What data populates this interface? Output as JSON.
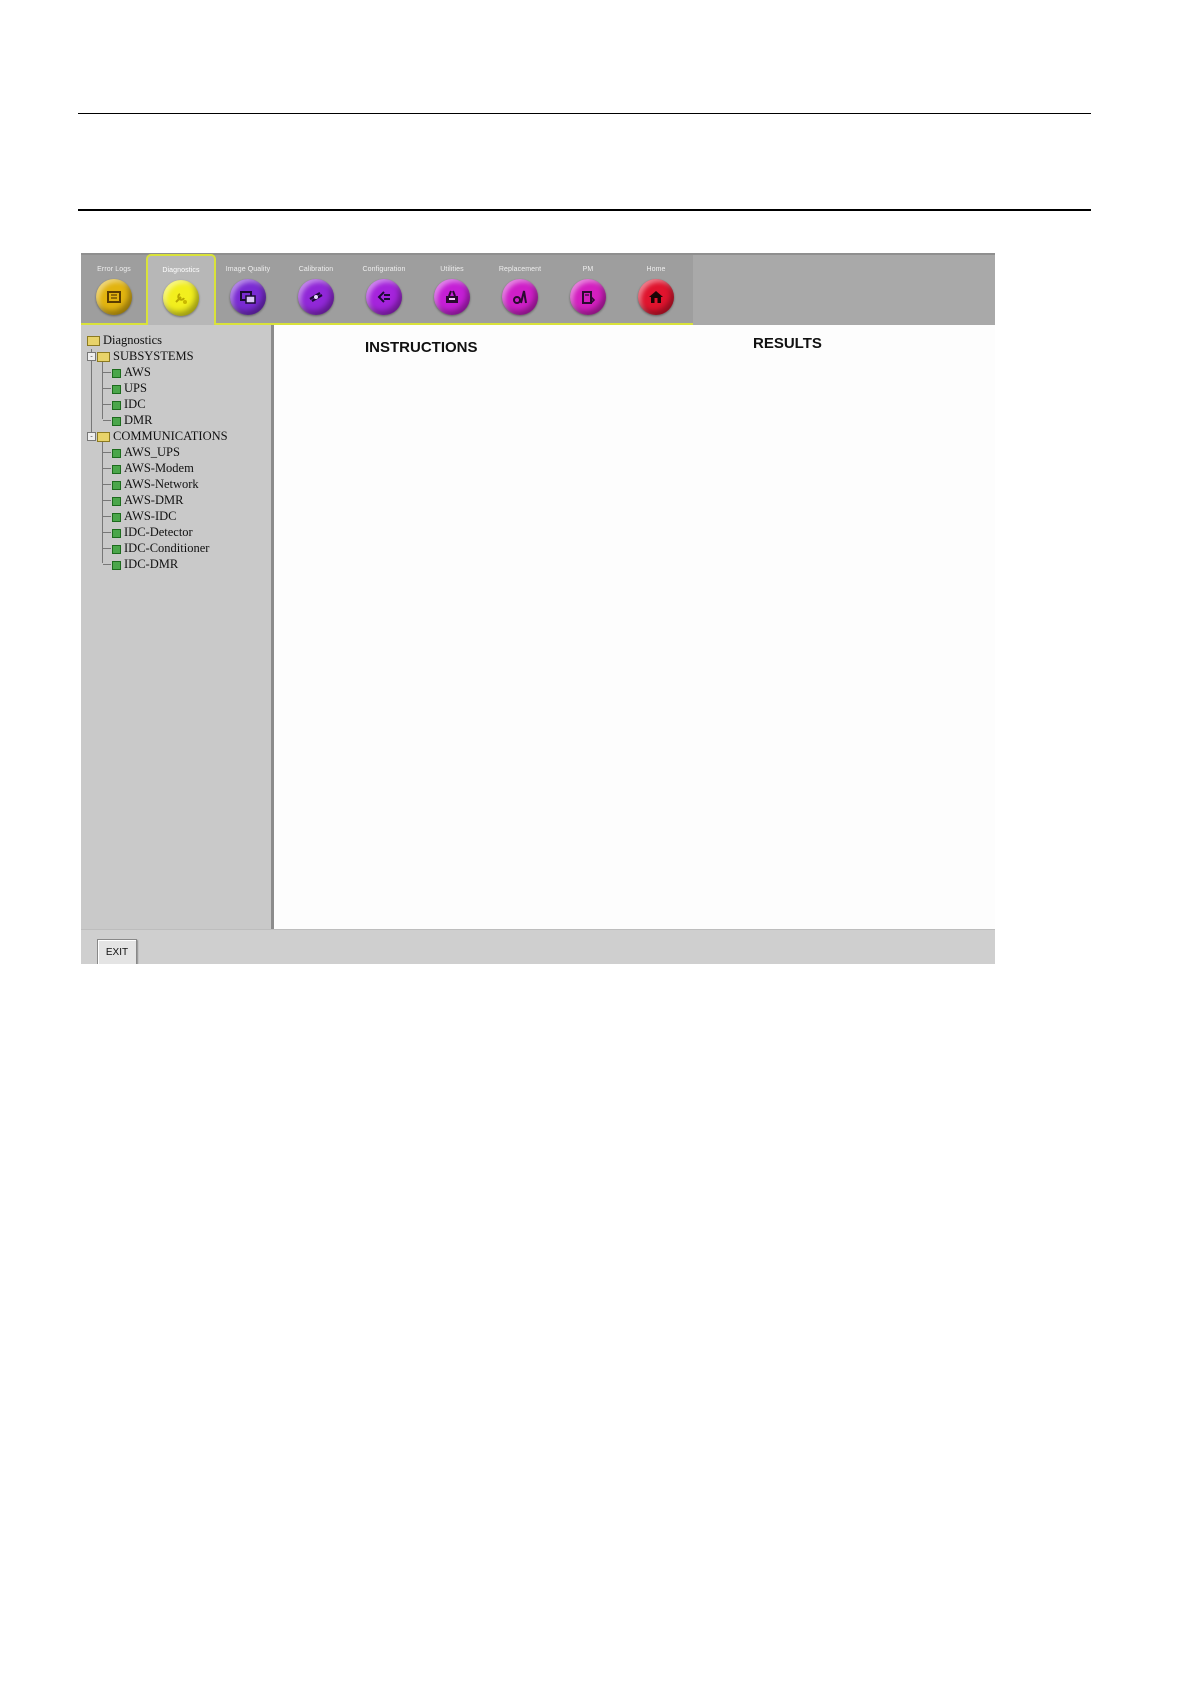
{
  "toolbar": {
    "tabs": [
      {
        "label": "Error Logs",
        "icon": "error-logs-icon",
        "color": "#e2b410"
      },
      {
        "label": "Diagnostics",
        "icon": "diagnostics-icon",
        "color": "#f2ef1e",
        "active": true
      },
      {
        "label": "Image Quality",
        "icon": "image-quality-icon",
        "color": "#7a2bd3"
      },
      {
        "label": "Calibration",
        "icon": "calibration-icon",
        "color": "#9128d8"
      },
      {
        "label": "Configuration",
        "icon": "configuration-icon",
        "color": "#a524dc"
      },
      {
        "label": "Utilities",
        "icon": "utilities-icon",
        "color": "#c51fd6"
      },
      {
        "label": "Replacement",
        "icon": "replacement-icon",
        "color": "#cf1fc8"
      },
      {
        "label": "PM",
        "icon": "pm-icon",
        "color": "#d41fc0"
      },
      {
        "label": "Home",
        "icon": "home-icon",
        "color": "#e0142e"
      }
    ],
    "accent_color": "#d9e23a"
  },
  "tree": {
    "root": "Diagnostics",
    "groups": [
      {
        "label": "SUBSYSTEMS",
        "items": [
          "AWS",
          "UPS",
          "IDC",
          "DMR"
        ]
      },
      {
        "label": "COMMUNICATIONS",
        "items": [
          "AWS_UPS",
          "AWS-Modem",
          "AWS-Network",
          "AWS-DMR",
          "AWS-IDC",
          "IDC-Detector",
          "IDC-Conditioner",
          "IDC-DMR"
        ]
      }
    ]
  },
  "content": {
    "instructions_heading": "INSTRUCTIONS",
    "results_heading": "RESULTS"
  },
  "footer": {
    "exit_label": "EXIT"
  }
}
